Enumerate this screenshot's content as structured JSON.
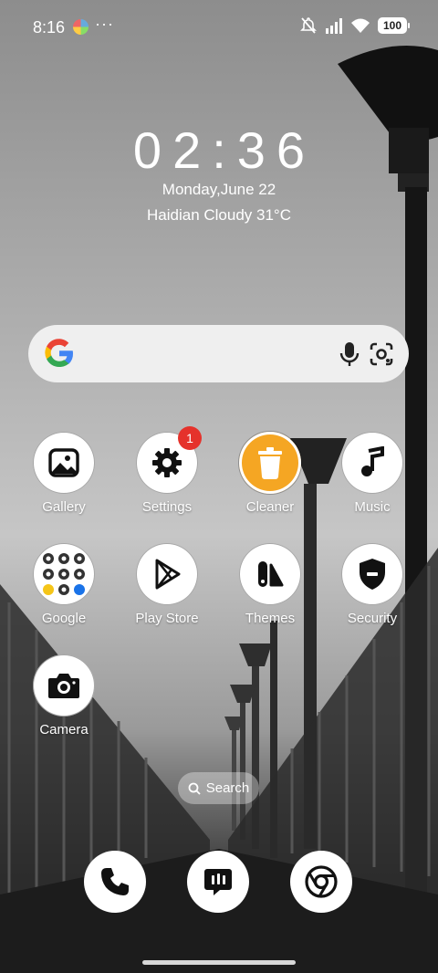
{
  "status_bar": {
    "time": "8:16",
    "more": "···",
    "battery": "100"
  },
  "clock": {
    "time": "02:36",
    "date": "Monday,June 22",
    "weather": "Haidian Cloudy 31°C"
  },
  "google_search": {
    "logo_icon": "google-g-icon",
    "mic_icon": "mic-icon",
    "lens_icon": "lens-icon"
  },
  "apps": [
    {
      "label": "Gallery",
      "icon": "gallery-icon"
    },
    {
      "label": "Settings",
      "icon": "gear-icon",
      "badge": "1"
    },
    {
      "label": "Cleaner",
      "icon": "trash-icon"
    },
    {
      "label": "Music",
      "icon": "music-note-icon"
    },
    {
      "label": "Google",
      "icon": "folder-icon"
    },
    {
      "label": "Play Store",
      "icon": "play-store-icon"
    },
    {
      "label": "Themes",
      "icon": "themes-icon"
    },
    {
      "label": "Security",
      "icon": "shield-icon"
    },
    {
      "label": "Camera",
      "icon": "camera-icon"
    }
  ],
  "home_search": {
    "label": "Search"
  },
  "dock": [
    {
      "icon": "phone-icon"
    },
    {
      "icon": "messages-icon"
    },
    {
      "icon": "chrome-icon"
    }
  ],
  "colors": {
    "cleaner_accent": "#f5a623",
    "badge": "#e5322b"
  }
}
